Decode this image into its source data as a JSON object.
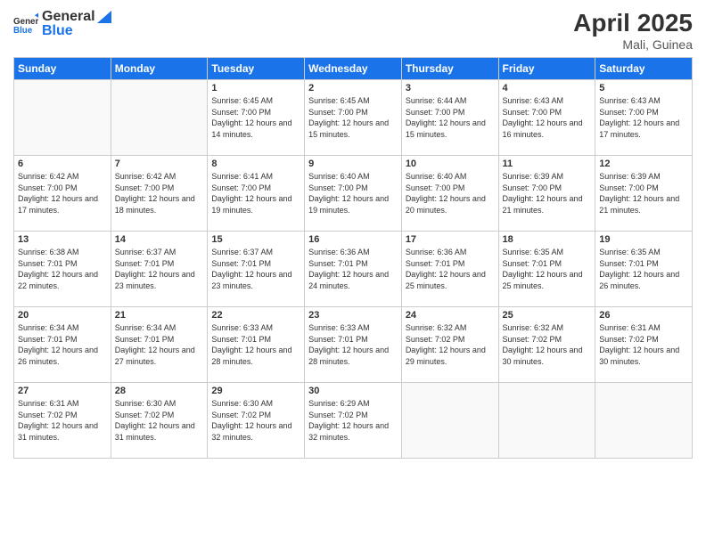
{
  "logo": {
    "text_general": "General",
    "text_blue": "Blue"
  },
  "title": {
    "month_year": "April 2025",
    "location": "Mali, Guinea"
  },
  "days_of_week": [
    "Sunday",
    "Monday",
    "Tuesday",
    "Wednesday",
    "Thursday",
    "Friday",
    "Saturday"
  ],
  "weeks": [
    [
      {
        "date": "",
        "info": ""
      },
      {
        "date": "",
        "info": ""
      },
      {
        "date": "1",
        "info": "Sunrise: 6:45 AM\nSunset: 7:00 PM\nDaylight: 12 hours and 14 minutes."
      },
      {
        "date": "2",
        "info": "Sunrise: 6:45 AM\nSunset: 7:00 PM\nDaylight: 12 hours and 15 minutes."
      },
      {
        "date": "3",
        "info": "Sunrise: 6:44 AM\nSunset: 7:00 PM\nDaylight: 12 hours and 15 minutes."
      },
      {
        "date": "4",
        "info": "Sunrise: 6:43 AM\nSunset: 7:00 PM\nDaylight: 12 hours and 16 minutes."
      },
      {
        "date": "5",
        "info": "Sunrise: 6:43 AM\nSunset: 7:00 PM\nDaylight: 12 hours and 17 minutes."
      }
    ],
    [
      {
        "date": "6",
        "info": "Sunrise: 6:42 AM\nSunset: 7:00 PM\nDaylight: 12 hours and 17 minutes."
      },
      {
        "date": "7",
        "info": "Sunrise: 6:42 AM\nSunset: 7:00 PM\nDaylight: 12 hours and 18 minutes."
      },
      {
        "date": "8",
        "info": "Sunrise: 6:41 AM\nSunset: 7:00 PM\nDaylight: 12 hours and 19 minutes."
      },
      {
        "date": "9",
        "info": "Sunrise: 6:40 AM\nSunset: 7:00 PM\nDaylight: 12 hours and 19 minutes."
      },
      {
        "date": "10",
        "info": "Sunrise: 6:40 AM\nSunset: 7:00 PM\nDaylight: 12 hours and 20 minutes."
      },
      {
        "date": "11",
        "info": "Sunrise: 6:39 AM\nSunset: 7:00 PM\nDaylight: 12 hours and 21 minutes."
      },
      {
        "date": "12",
        "info": "Sunrise: 6:39 AM\nSunset: 7:00 PM\nDaylight: 12 hours and 21 minutes."
      }
    ],
    [
      {
        "date": "13",
        "info": "Sunrise: 6:38 AM\nSunset: 7:01 PM\nDaylight: 12 hours and 22 minutes."
      },
      {
        "date": "14",
        "info": "Sunrise: 6:37 AM\nSunset: 7:01 PM\nDaylight: 12 hours and 23 minutes."
      },
      {
        "date": "15",
        "info": "Sunrise: 6:37 AM\nSunset: 7:01 PM\nDaylight: 12 hours and 23 minutes."
      },
      {
        "date": "16",
        "info": "Sunrise: 6:36 AM\nSunset: 7:01 PM\nDaylight: 12 hours and 24 minutes."
      },
      {
        "date": "17",
        "info": "Sunrise: 6:36 AM\nSunset: 7:01 PM\nDaylight: 12 hours and 25 minutes."
      },
      {
        "date": "18",
        "info": "Sunrise: 6:35 AM\nSunset: 7:01 PM\nDaylight: 12 hours and 25 minutes."
      },
      {
        "date": "19",
        "info": "Sunrise: 6:35 AM\nSunset: 7:01 PM\nDaylight: 12 hours and 26 minutes."
      }
    ],
    [
      {
        "date": "20",
        "info": "Sunrise: 6:34 AM\nSunset: 7:01 PM\nDaylight: 12 hours and 26 minutes."
      },
      {
        "date": "21",
        "info": "Sunrise: 6:34 AM\nSunset: 7:01 PM\nDaylight: 12 hours and 27 minutes."
      },
      {
        "date": "22",
        "info": "Sunrise: 6:33 AM\nSunset: 7:01 PM\nDaylight: 12 hours and 28 minutes."
      },
      {
        "date": "23",
        "info": "Sunrise: 6:33 AM\nSunset: 7:01 PM\nDaylight: 12 hours and 28 minutes."
      },
      {
        "date": "24",
        "info": "Sunrise: 6:32 AM\nSunset: 7:02 PM\nDaylight: 12 hours and 29 minutes."
      },
      {
        "date": "25",
        "info": "Sunrise: 6:32 AM\nSunset: 7:02 PM\nDaylight: 12 hours and 30 minutes."
      },
      {
        "date": "26",
        "info": "Sunrise: 6:31 AM\nSunset: 7:02 PM\nDaylight: 12 hours and 30 minutes."
      }
    ],
    [
      {
        "date": "27",
        "info": "Sunrise: 6:31 AM\nSunset: 7:02 PM\nDaylight: 12 hours and 31 minutes."
      },
      {
        "date": "28",
        "info": "Sunrise: 6:30 AM\nSunset: 7:02 PM\nDaylight: 12 hours and 31 minutes."
      },
      {
        "date": "29",
        "info": "Sunrise: 6:30 AM\nSunset: 7:02 PM\nDaylight: 12 hours and 32 minutes."
      },
      {
        "date": "30",
        "info": "Sunrise: 6:29 AM\nSunset: 7:02 PM\nDaylight: 12 hours and 32 minutes."
      },
      {
        "date": "",
        "info": ""
      },
      {
        "date": "",
        "info": ""
      },
      {
        "date": "",
        "info": ""
      }
    ]
  ]
}
